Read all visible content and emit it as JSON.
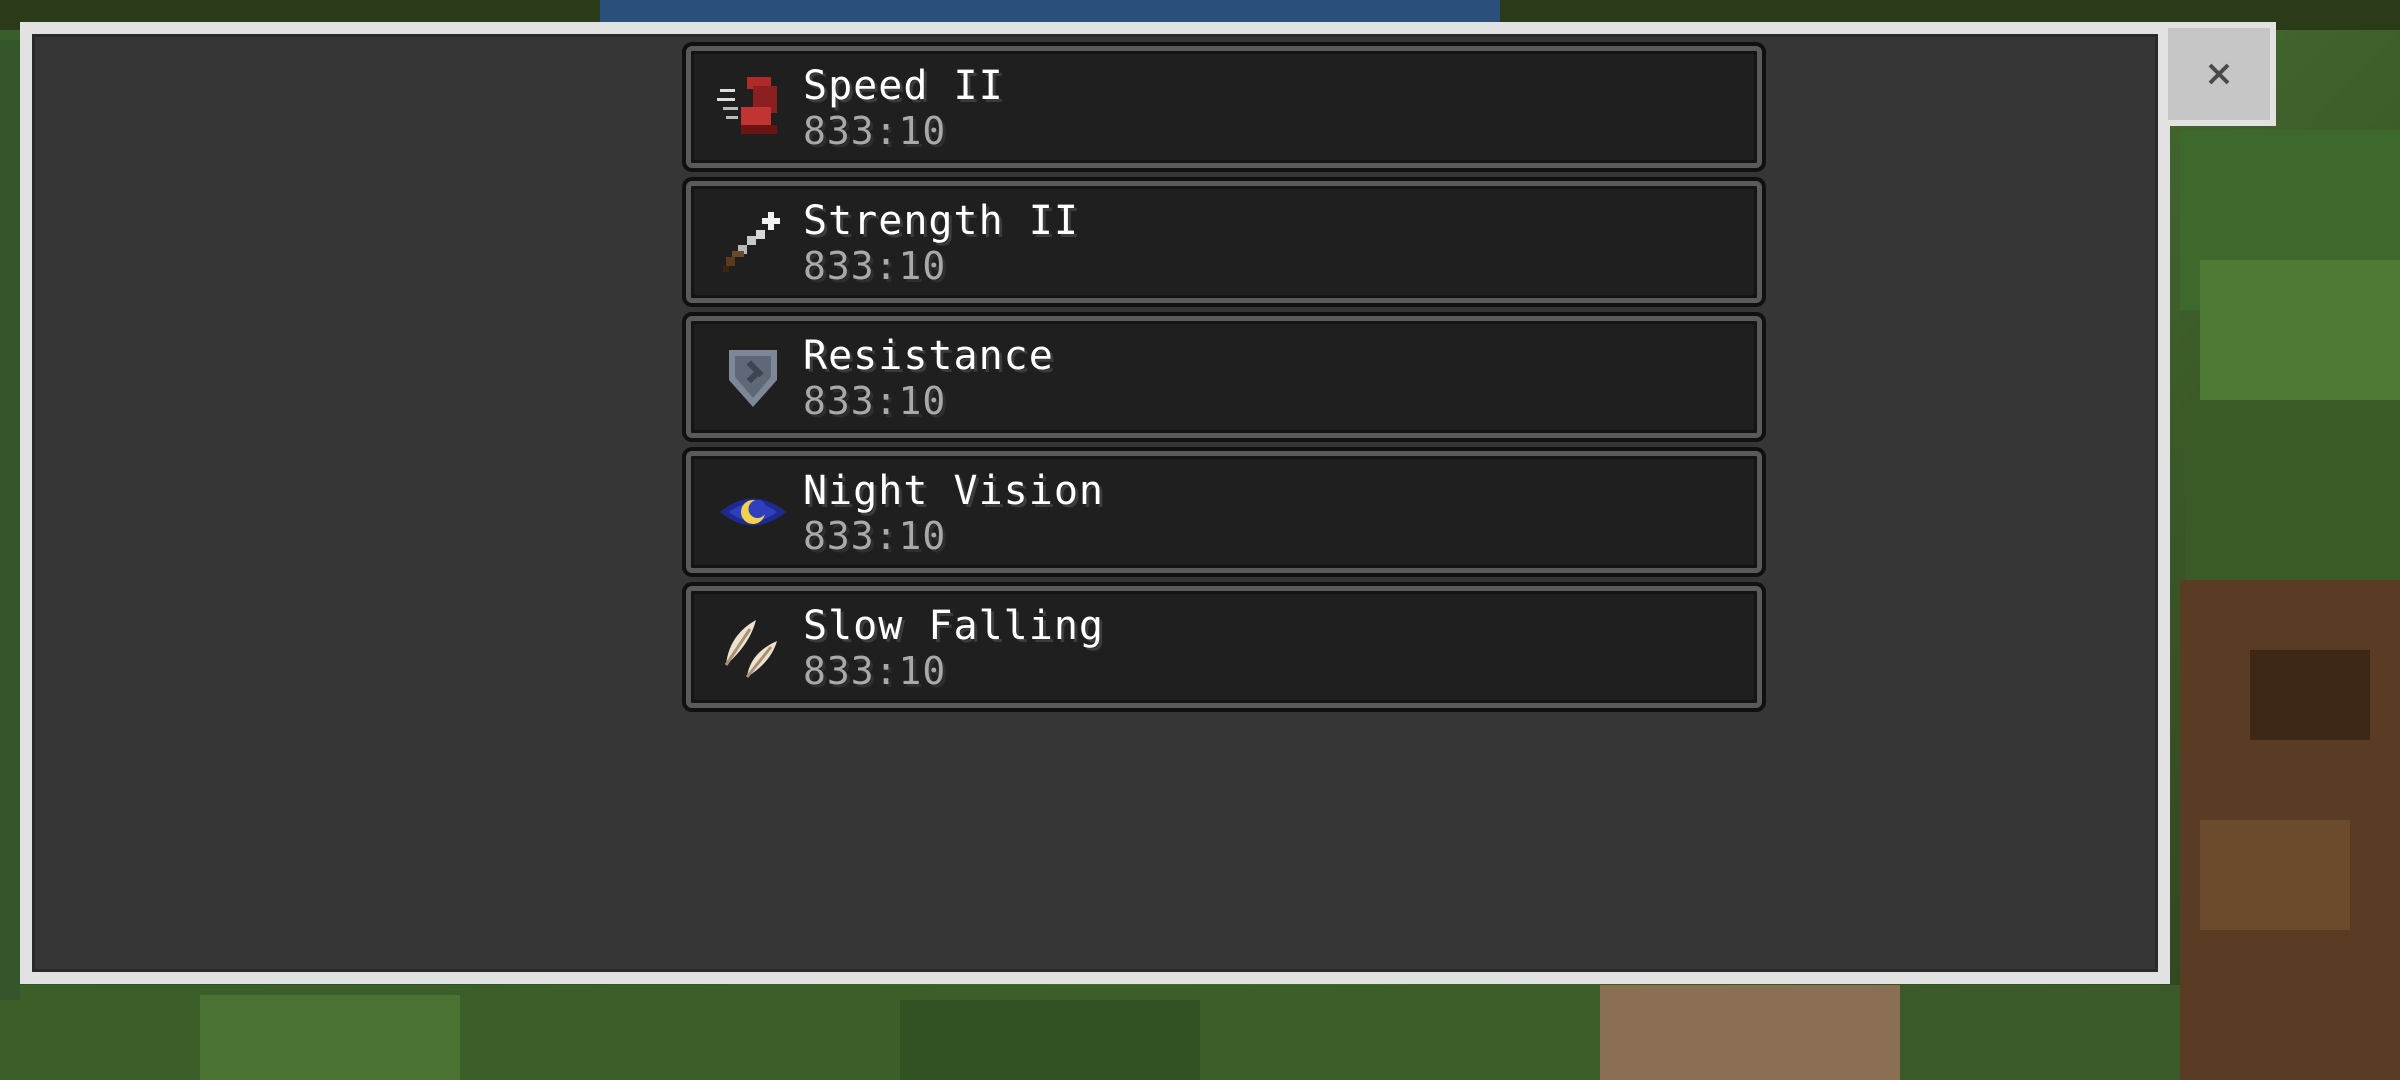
{
  "close_button": {
    "symbol": "×"
  },
  "effects": [
    {
      "name": "Speed II",
      "duration": "833:10",
      "icon": "speed-icon"
    },
    {
      "name": "Strength II",
      "duration": "833:10",
      "icon": "strength-icon"
    },
    {
      "name": "Resistance",
      "duration": "833:10",
      "icon": "resistance-icon"
    },
    {
      "name": "Night Vision",
      "duration": "833:10",
      "icon": "night-vision-icon"
    },
    {
      "name": "Slow Falling",
      "duration": "833:10",
      "icon": "slow-falling-icon"
    }
  ],
  "colors": {
    "panel_bg": "#363636",
    "panel_border": "#e2e2e2",
    "entry_bg": "#1f1f1f",
    "name_text": "#ffffff",
    "time_text": "#a9a9a9"
  }
}
